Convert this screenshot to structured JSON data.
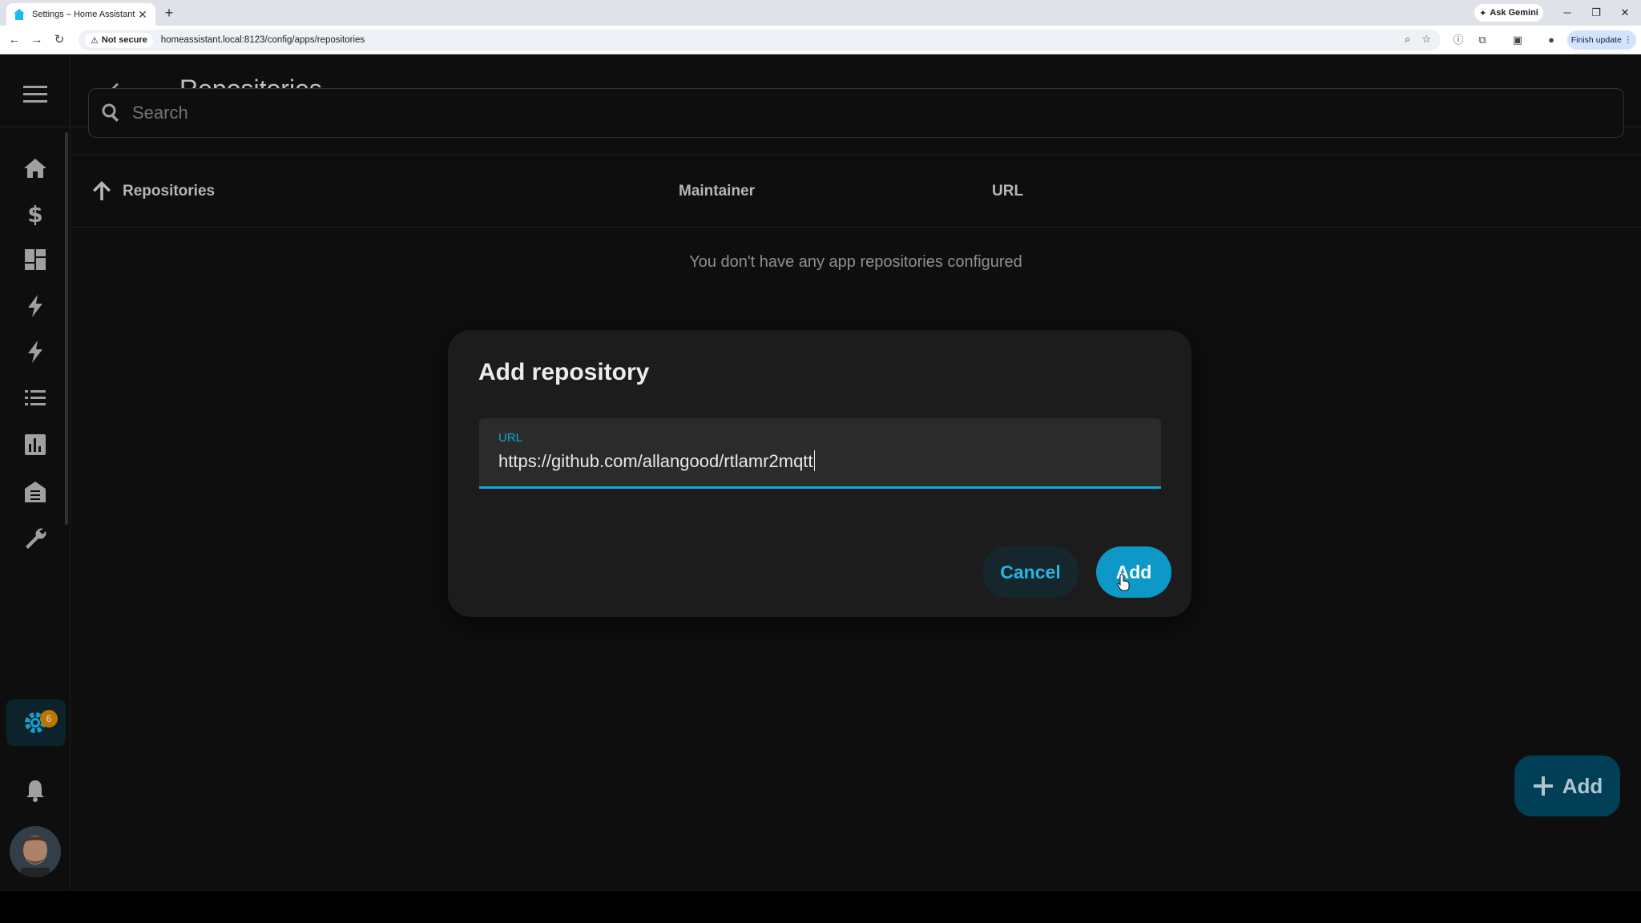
{
  "browser": {
    "tab_title": "Settings – Home Assistant",
    "new_tab": "+",
    "ask_gemini": "Ask Gemini",
    "not_secure": "Not secure",
    "url": "homeassistant.local:8123/config/apps/repositories",
    "finish_update": "Finish update"
  },
  "header": {
    "title": "Repositories"
  },
  "search": {
    "placeholder": "Search"
  },
  "table": {
    "columns": [
      "Repositories",
      "Maintainer",
      "URL"
    ],
    "empty_message": "You don't have any app repositories configured"
  },
  "sidebar": {
    "notification_badge": "6"
  },
  "dialog": {
    "title": "Add repository",
    "field_label": "URL",
    "field_value": "https://github.com/allangood/rtlamr2mqtt",
    "cancel_label": "Cancel",
    "add_label": "Add"
  },
  "fab": {
    "label": "Add"
  },
  "colors": {
    "accent": "#10a9d9",
    "badge": "#e08a00",
    "fab_bg": "#004b66"
  }
}
